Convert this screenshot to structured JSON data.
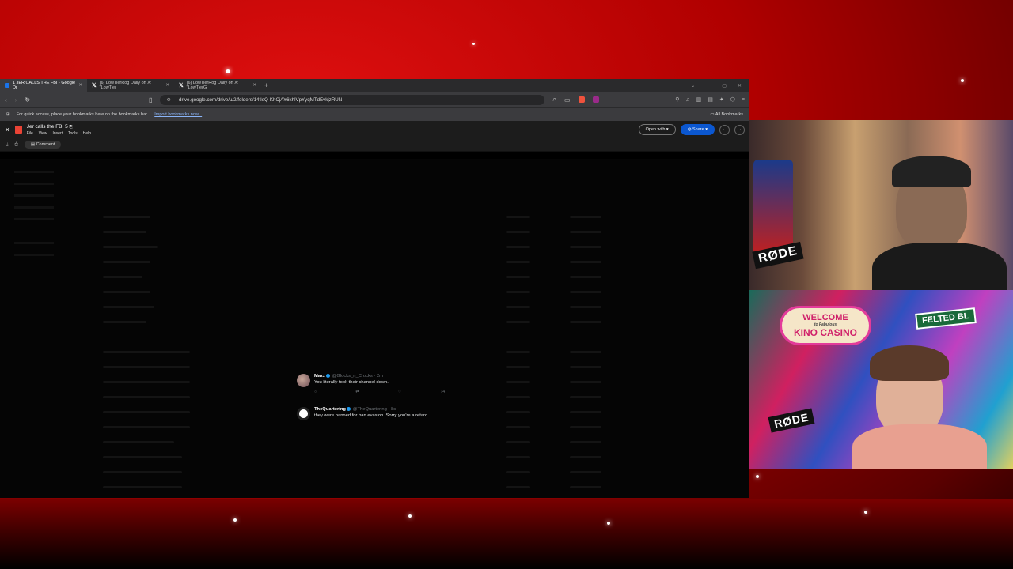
{
  "colors": {
    "background_red": "#c00000",
    "share_blue": "#0b57d0",
    "twitter_blue": "#1d9bf0"
  },
  "tabs": [
    {
      "title": "1 JER CALLS THE FBI - Google Dr",
      "active": true,
      "icon": "google-drive-icon"
    },
    {
      "title": "(6) LowTierRog Daily on X: \"LowTier",
      "active": false,
      "icon": "x-logo-icon"
    },
    {
      "title": "(6) LowTierRog Daily on X: \"LowTierG",
      "active": false,
      "icon": "x-logo-icon"
    }
  ],
  "address_bar": {
    "url": "drive.google.com/drive/u/2/folders/14tleQ-KhCjAY6khlVpYyqMTdEvkjzRUN"
  },
  "bookmarks_bar": {
    "message": "For quick access, place your bookmarks here on the bookmarks bar.",
    "import_link": "Import bookmarks now...",
    "all_bookmarks": "All Bookmarks"
  },
  "viewer": {
    "title": "Jer calls the FBI 5",
    "menu": [
      "File",
      "View",
      "Insert",
      "Tools",
      "Help"
    ],
    "open_with": "Open with",
    "share": "Share",
    "comment": "Comment"
  },
  "tweets": [
    {
      "name": "Mazz",
      "handle": "@Glocks_n_Crocks · 2m",
      "text": "You literally took their channel down.",
      "likes": "4"
    },
    {
      "name": "TheQuartering",
      "handle": "@TheQuartering · 8s",
      "text": "they were banned for ban evasion. Sorry you're a retard."
    }
  ],
  "webcam_bottom": {
    "sign_welcome": "WELCOME",
    "sign_subtitle": "to Fabulous",
    "sign_name": "KINO CASINO",
    "street_sign": "FELTED BL",
    "mic_brand": "RØDE"
  },
  "webcam_top": {
    "mic_brand": "RØDE"
  }
}
